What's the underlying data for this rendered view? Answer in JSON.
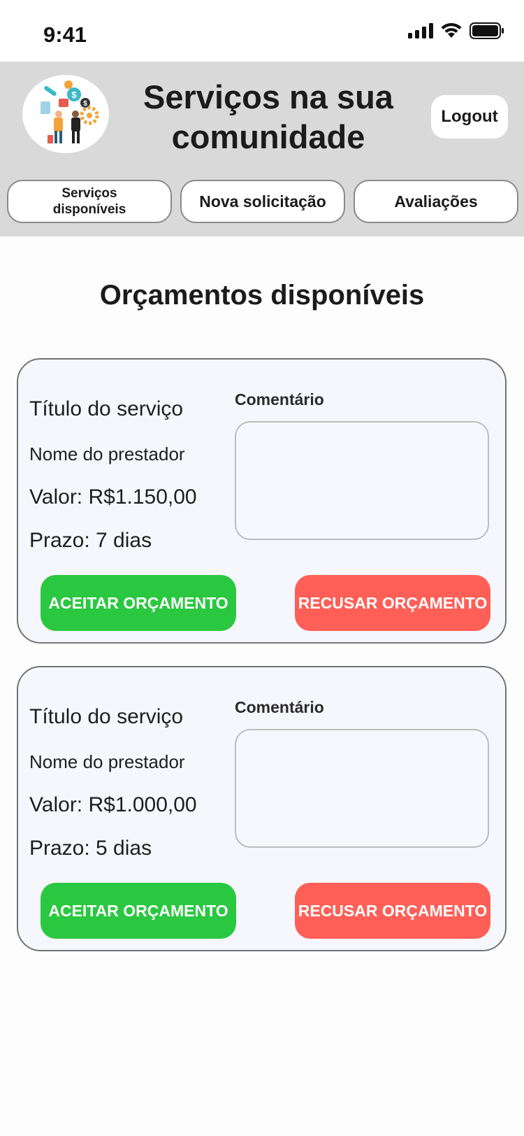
{
  "status_bar": {
    "time": "9:41"
  },
  "header": {
    "title": "Serviços na sua comunidade",
    "logout_label": "Logout"
  },
  "tabs": [
    {
      "label": "Serviços disponíveis"
    },
    {
      "label": "Nova solicitação"
    },
    {
      "label": "Avaliações"
    }
  ],
  "page_title": "Orçamentos disponíveis",
  "quotes": [
    {
      "service_title": "Título do serviço",
      "provider": "Nome do prestador",
      "price": "Valor: R$1.150,00",
      "deadline": "Prazo: 7 dias",
      "comment_label": "Comentário",
      "comment_value": "",
      "accept_label": "ACEITAR ORÇAMENTO",
      "reject_label": "RECUSAR ORÇAMENTO"
    },
    {
      "service_title": "Título do serviço",
      "provider": "Nome do prestador",
      "price": "Valor: R$1.000,00",
      "deadline": "Prazo: 5 dias",
      "comment_label": "Comentário",
      "comment_value": "",
      "accept_label": "ACEITAR ORÇAMENTO",
      "reject_label": "RECUSAR ORÇAMENTO"
    }
  ],
  "colors": {
    "header_bg": "#d9d9d9",
    "accept": "#2ac840",
    "reject": "#ff5f57",
    "card_bg": "#f6f7fd"
  },
  "icons": [
    "cellular-signal-icon",
    "wifi-icon",
    "battery-icon",
    "community-services-logo"
  ]
}
